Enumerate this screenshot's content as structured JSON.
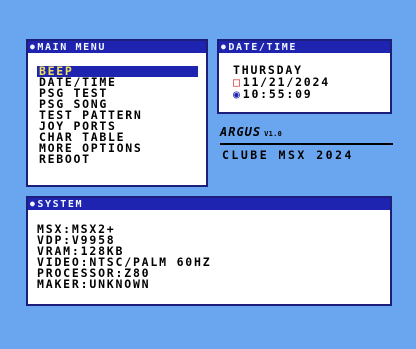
{
  "main_menu": {
    "title": "MAIN MENU",
    "items": [
      {
        "label": "BEEP",
        "selected": true
      },
      {
        "label": "DATE/TIME",
        "selected": false
      },
      {
        "label": "PSG TEST",
        "selected": false
      },
      {
        "label": "PSG SONG",
        "selected": false
      },
      {
        "label": "TEST PATTERN",
        "selected": false
      },
      {
        "label": "JOY PORTS",
        "selected": false
      },
      {
        "label": "CHAR TABLE",
        "selected": false
      },
      {
        "label": "MORE OPTIONS",
        "selected": false
      },
      {
        "label": "REBOOT",
        "selected": false
      }
    ]
  },
  "date_time": {
    "title": "DATE/TIME",
    "weekday": "THURSDAY",
    "date": "11/21/2024",
    "time": "10:55:09",
    "date_icon": "calendar-icon",
    "time_icon": "clock-icon"
  },
  "branding": {
    "name": "ARGUS",
    "version": "V1.0",
    "credit": "CLUBE MSX 2024"
  },
  "system": {
    "title": "SYSTEM",
    "lines": [
      "MSX:MSX2+",
      "VDP:V9958",
      "VRAM:128KB",
      "VIDEO:NTSC/PALM 60HZ",
      "PROCESSOR:Z80",
      "MAKER:UNKNOWN"
    ]
  },
  "colors": {
    "background": "#6aa6ef",
    "title_bar": "#1e24b0",
    "selection_text": "#f0e05a",
    "panel": "#ffffff",
    "text": "#000000"
  }
}
